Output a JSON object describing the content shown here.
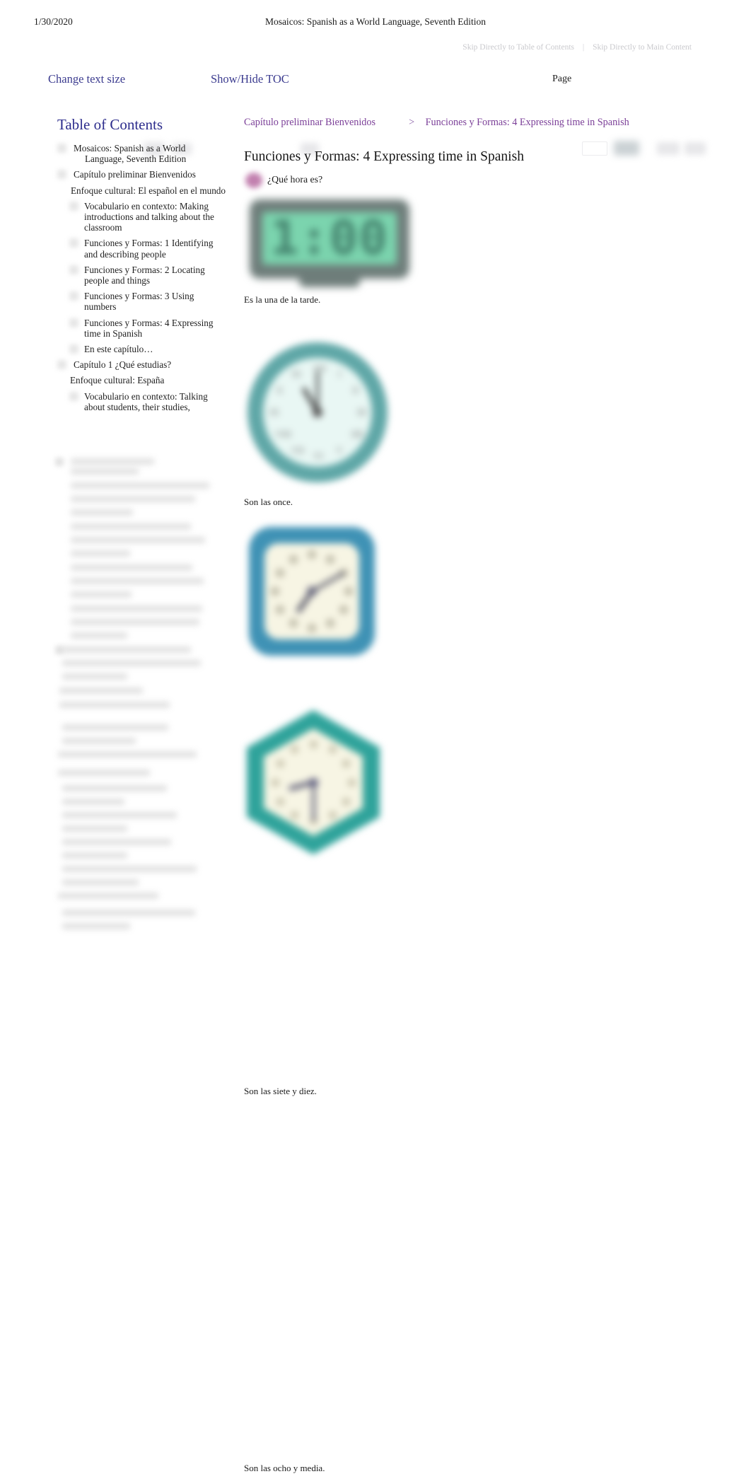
{
  "print_header": {
    "date": "1/30/2020",
    "title": "Mosaicos: Spanish as a World Language, Seventh Edition"
  },
  "skip_links": {
    "toc": "Skip Directly to Table of Contents",
    "separator": "|",
    "main": "Skip Directly to Main Content"
  },
  "toolbar": {
    "text_size_label": "Change text size",
    "toc_toggle_label": "Show/Hide TOC",
    "page_label": "Page",
    "page_value": "",
    "page_placeholder": "",
    "accent_color": "#3b3b8f"
  },
  "toc": {
    "title": "Table of Contents",
    "items": [
      {
        "label": "Mosaicos: Spanish as a World Language, Seventh Edition",
        "level": 0
      },
      {
        "label": "Capítulo preliminar Bienvenidos",
        "level": 0
      },
      {
        "label": "Enfoque cultural: El español en el mundo",
        "level": 1
      },
      {
        "label": "Vocabulario en contexto: Making introductions and talking about the classroom",
        "level": 2
      },
      {
        "label": "Funciones y Formas: 1 Identifying and describing people",
        "level": 2
      },
      {
        "label": "Funciones y Formas: 2 Locating people and things",
        "level": 2
      },
      {
        "label": "Funciones y Formas: 3 Using numbers",
        "level": 2
      },
      {
        "label": "Funciones y Formas: 4 Expressing time in Spanish",
        "level": 2
      },
      {
        "label": "En este capítulo…",
        "level": 2
      },
      {
        "label": "Capítulo 1 ¿Qué estudias?",
        "level": 0
      },
      {
        "label": "Enfoque cultural: España",
        "level": 1
      },
      {
        "label": "Vocabulario en contexto: Talking about students, their studies,",
        "level": 2
      }
    ],
    "title_color": "#2c2c8c"
  },
  "breadcrumb": {
    "parent": "Capítulo preliminar Bienvenidos",
    "separator": ">",
    "current": "Funciones y Formas: 4 Expressing time in Spanish",
    "color": "#7b3f98"
  },
  "content": {
    "section_title": "Funciones y Formas: 4 Expressing time in Spanish",
    "subhead": "¿Qué hora es?",
    "subhead_bullet_color": "#b3619b",
    "figures": [
      {
        "kind": "digital-clock",
        "display": "1:00",
        "caption": "Es la una de la tarde.",
        "screen_color": "#7bd4ae",
        "body_color": "#6e7d7a"
      },
      {
        "kind": "round-clock",
        "time": "11:00",
        "hour": 11,
        "minute": 0,
        "caption": "Son las once.",
        "bezel_color": "#5fa7a7",
        "face_color": "#e9f7f4"
      },
      {
        "kind": "square-clock",
        "time": "7:10",
        "hour": 7,
        "minute": 10,
        "caption": "Son las siete y diez.",
        "bezel_color": "#3f92b5",
        "face_color": "#f7f5e4"
      },
      {
        "kind": "hexagon-clock",
        "time": "8:30",
        "hour": 8,
        "minute": 30,
        "caption": "Son las ocho y media.",
        "bezel_color": "#2fa39b",
        "face_color": "#f7f5e4"
      }
    ]
  }
}
